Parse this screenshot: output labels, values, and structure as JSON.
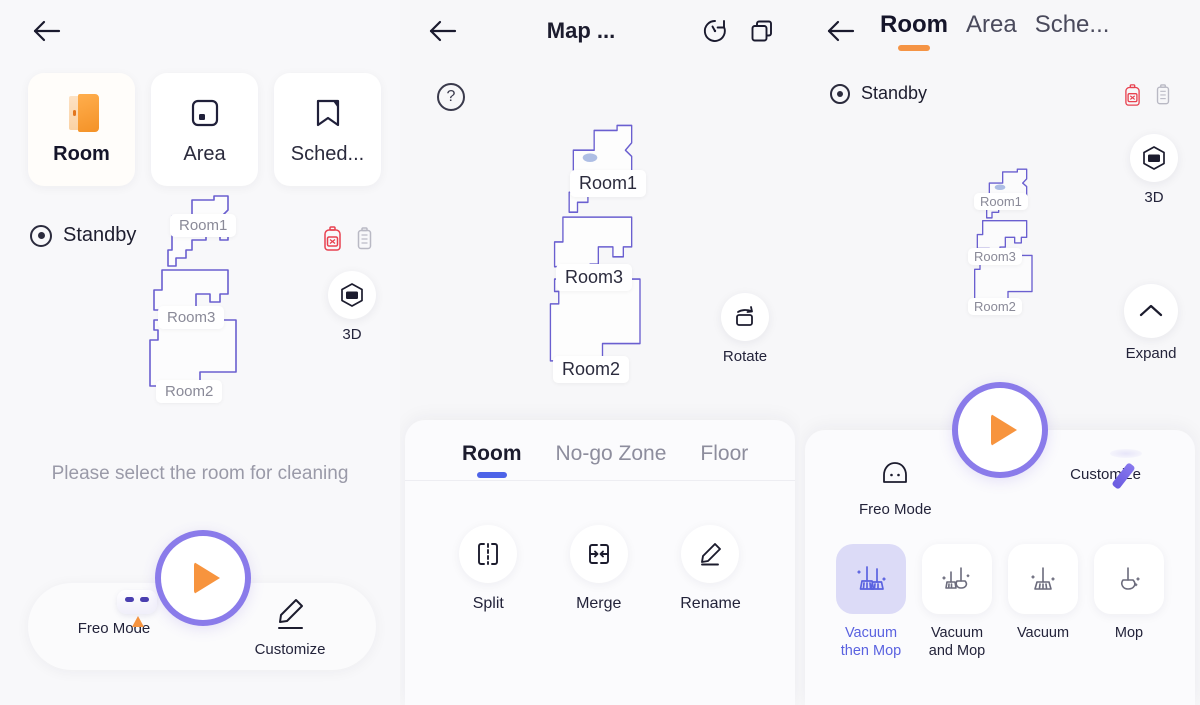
{
  "panel1": {
    "nav": {
      "back": "back-arrow-icon",
      "menu": "hamburger-menu-icon"
    },
    "mode_cards": [
      {
        "label": "Room",
        "icon": "door-icon",
        "active": true
      },
      {
        "label": "Area",
        "icon": "area-square-icon",
        "active": false
      },
      {
        "label": "Sched...",
        "icon": "bookmark-icon",
        "active": false
      }
    ],
    "status": {
      "label": "Standby",
      "icon": "status-standby-icon"
    },
    "status_icons": [
      {
        "name": "water-tank-empty-icon",
        "color": "#e8414f"
      },
      {
        "name": "battery-icon",
        "color": "#b9b9c4"
      }
    ],
    "map": {
      "rooms": [
        {
          "label": "Room1"
        },
        {
          "label": "Room3"
        },
        {
          "label": "Room2"
        }
      ]
    },
    "tool_3d": {
      "label": "3D",
      "icon": "cube-3d-icon"
    },
    "hint": "Please select the room for cleaning",
    "action_bar": {
      "left": {
        "label": "Freo Mode",
        "icon": "robot-head-icon"
      },
      "right": {
        "label": "Customize",
        "icon": "pencil-icon"
      },
      "start": {
        "name": "start-button",
        "icon": "play-icon",
        "ring_color": "#8a7bea",
        "play_color": "#f7943e"
      }
    }
  },
  "panel2": {
    "nav": {
      "back": "back-arrow-icon",
      "title": "Map ...",
      "history": "history-restore-icon",
      "copy": "duplicate-maps-icon"
    },
    "help": {
      "label": "?",
      "name": "help-icon"
    },
    "map": {
      "rooms": [
        {
          "label": "Room1"
        },
        {
          "label": "Room3"
        },
        {
          "label": "Room2"
        }
      ]
    },
    "rotate_tool": {
      "label": "Rotate",
      "icon": "rotate-icon"
    },
    "sheet": {
      "tabs": [
        {
          "label": "Room",
          "active": true
        },
        {
          "label": "No-go Zone",
          "active": false
        },
        {
          "label": "Floor",
          "active": false
        }
      ],
      "actions": [
        {
          "label": "Split",
          "icon": "split-icon"
        },
        {
          "label": "Merge",
          "icon": "merge-icon"
        },
        {
          "label": "Rename",
          "icon": "pencil-edit-icon"
        }
      ],
      "indicator_color": "#4d63e8"
    }
  },
  "panel3": {
    "nav": {
      "back": "back-arrow-icon",
      "menu": "hamburger-menu-icon",
      "tabs": [
        {
          "label": "Room",
          "active": true
        },
        {
          "label": "Area",
          "active": false
        },
        {
          "label": "Sche...",
          "active": false
        }
      ],
      "indicator_color": "#f59445"
    },
    "status": {
      "label": "Standby",
      "icon": "status-standby-icon"
    },
    "status_icons": [
      {
        "name": "water-tank-empty-icon",
        "color": "#e8414f"
      },
      {
        "name": "battery-icon",
        "color": "#b9b9c4"
      }
    ],
    "map": {
      "rooms": [
        {
          "label": "Room1"
        },
        {
          "label": "Room3"
        },
        {
          "label": "Room2"
        }
      ]
    },
    "tools": [
      {
        "label": "3D",
        "icon": "cube-3d-icon"
      },
      {
        "label": "Expand",
        "icon": "chevron-up-icon"
      }
    ],
    "modes": {
      "left": {
        "label": "Freo Mode",
        "icon": "robot-head-outline-icon"
      },
      "right": {
        "label": "Customize",
        "icon": "pencil-3d-icon"
      },
      "start": {
        "name": "start-button",
        "icon": "play-icon",
        "ring_color": "#8a7bea",
        "play_color": "#f7943e"
      }
    },
    "clean_modes": [
      {
        "label": "Vacuum then Mop",
        "line1": "Vacuum",
        "line2": "then Mop",
        "icon": "vacuum-then-mop-icon",
        "selected": true
      },
      {
        "label": "Vacuum and Mop",
        "line1": "Vacuum",
        "line2": "and Mop",
        "icon": "vacuum-and-mop-icon",
        "selected": false
      },
      {
        "label": "Vacuum",
        "line1": "Vacuum",
        "line2": "",
        "icon": "vacuum-icon",
        "selected": false
      },
      {
        "label": "Mop",
        "line1": "Mop",
        "line2": "",
        "icon": "mop-icon",
        "selected": false
      }
    ],
    "selected_color": "#5a62e0"
  }
}
